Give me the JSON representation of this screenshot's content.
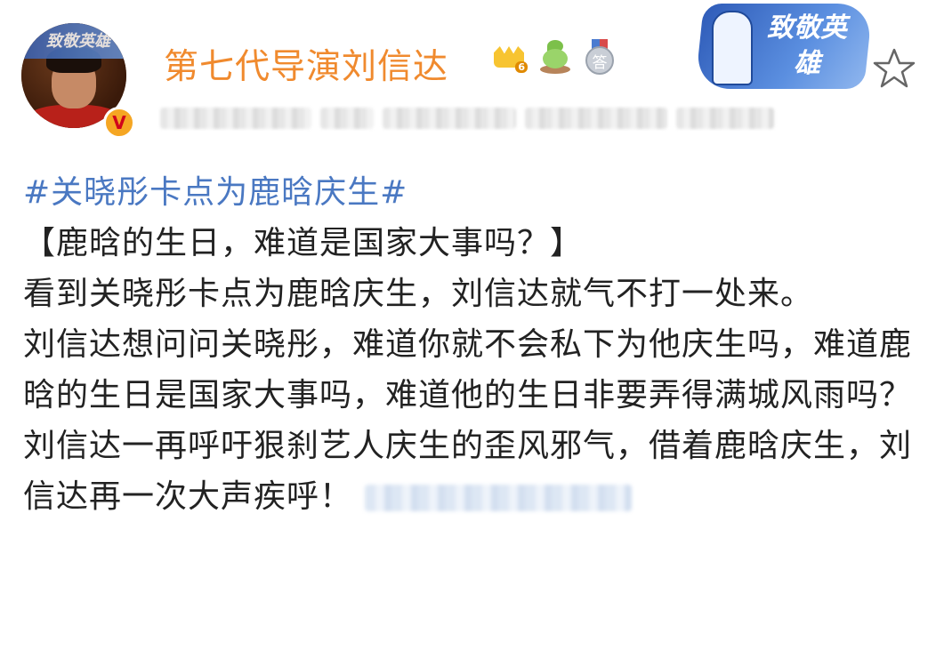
{
  "header": {
    "username": "第七代导演刘信达",
    "verified_badge": "V",
    "crown_badge_level": "6",
    "medal_badge_text": "答",
    "hero_badge_text": "致敬英雄",
    "avatar_frame_text": "致敬英雄",
    "colors": {
      "username": "#f08a2e",
      "topic": "#4a78c2",
      "hero_badge": "#2e5bb8"
    },
    "icons": [
      "crown-icon",
      "sprout-icon",
      "medal-icon",
      "star-icon"
    ]
  },
  "post": {
    "topic": "#关晓彤卡点为鹿晗庆生#",
    "paragraphs": [
      "【鹿晗的生日，难道是国家大事吗？】",
      "看到关晓彤卡点为鹿晗庆生，刘信达就气不打一处来。",
      "刘信达想问问关晓彤，难道你就不会私下为他庆生吗，难道鹿晗的生日是国家大事吗，难道他的生日非要弄得满城风雨吗？",
      "刘信达一再呼吁狠刹艺人庆生的歪风邪气，借着鹿晗庆生，刘信达再一次大声疾呼！"
    ]
  }
}
